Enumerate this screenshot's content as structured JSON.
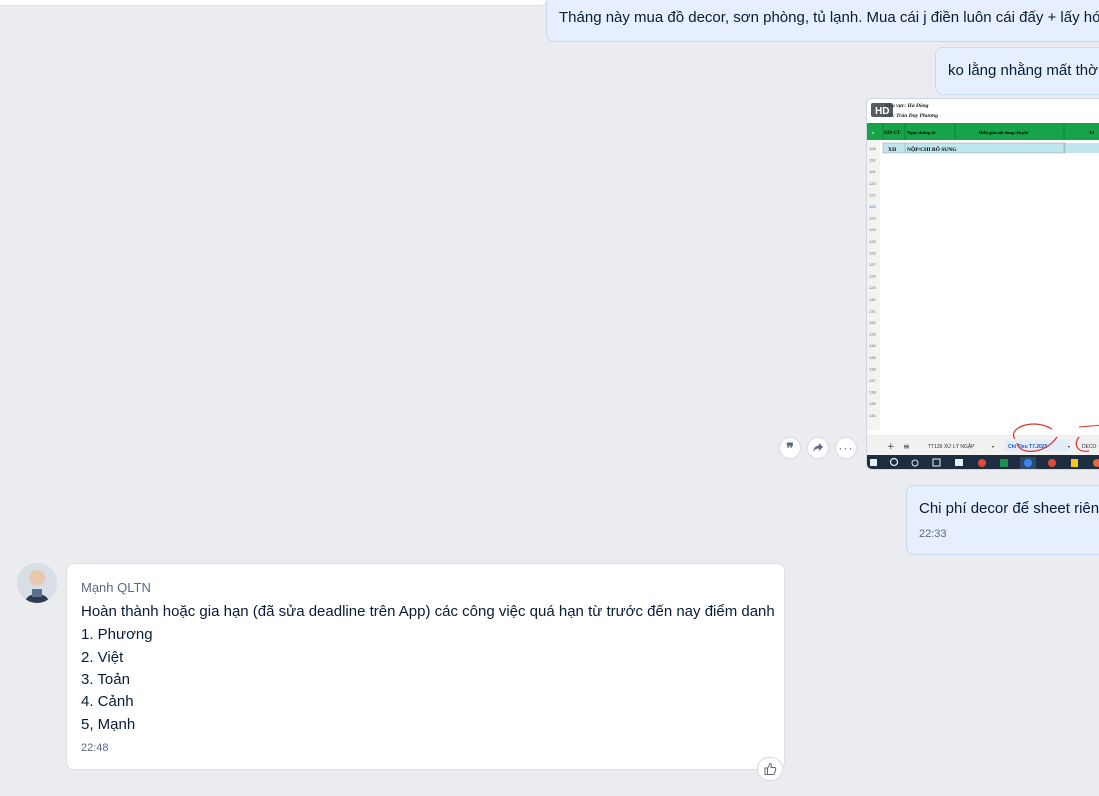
{
  "outgoing": {
    "msg1": "Tháng này mua đồ decor, sơn phòng, tủ lạnh. Mua cái j điền luôn cái đấy + lấy hó",
    "msg2": "ko lằng nhằng mất thờ",
    "image": {
      "badge": "HD",
      "header1": "Khu vực: Hà Đông",
      "header2": "GĐ: Trần Duy Phương",
      "col_headers": [
        "#",
        "S29-CT",
        "Ngày chứng từ",
        "Diễn giải nội dung chi phí",
        "Tổ"
      ],
      "section_code": "XII",
      "section_title": "NỘP/CHI BỔ SUNG",
      "row_numbers": [
        "108",
        "118",
        "119",
        "120",
        "121",
        "122",
        "123",
        "124",
        "125",
        "126",
        "127",
        "128",
        "129",
        "130",
        "131",
        "132",
        "133",
        "134",
        "135",
        "136",
        "137",
        "138",
        "139",
        "140"
      ],
      "sheet_tabs": [
        "TT139 XỬ LÝ NGẬP",
        "Chi Tieu T7.2025",
        "DECO"
      ]
    },
    "msg4": "Chi phí decor để sheet riên",
    "msg4_time": "22:33"
  },
  "actions": {
    "quote_icon": "quote-icon",
    "forward_icon": "share-icon",
    "more_icon": "more-icon"
  },
  "incoming": {
    "sender": "Mạnh QLTN",
    "line1": "Hoàn thành hoặc gia hạn (đã sửa deadline trên App) các công việc quá hạn từ trước đến nay điểm danh",
    "items": [
      "1. Phương",
      "2. Việt",
      "3. Toản",
      "4. Cảnh",
      "5, Mạnh"
    ],
    "time": "22:48",
    "reaction_icon": "thumbs-up-icon"
  },
  "colors": {
    "background": "#ebecf0",
    "outgoing_bubble": "#e5efff",
    "incoming_bubble": "#ffffff",
    "sheet_header_green": "#16a34a"
  }
}
